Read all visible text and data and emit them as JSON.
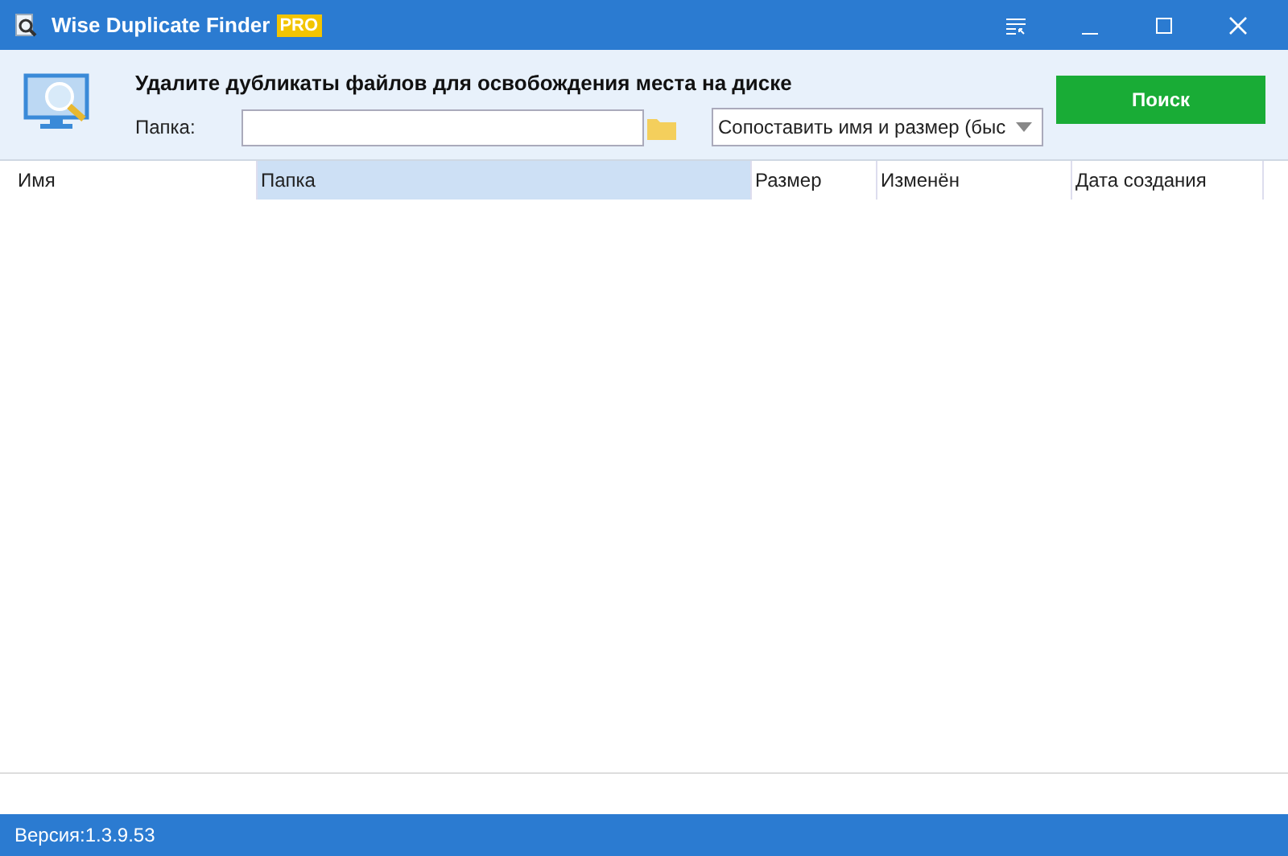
{
  "window": {
    "title": "Wise Duplicate Finder",
    "badge": "PRO"
  },
  "header": {
    "heading": "Удалите дубликаты файлов для освобождения места на диске",
    "folder_label": "Папка:",
    "mode": "Сопоставить имя и размер (быс",
    "search_button": "Поиск"
  },
  "table": {
    "columns": [
      {
        "label": "Имя",
        "selected": false
      },
      {
        "label": "Папка",
        "selected": true
      },
      {
        "label": "Размер",
        "selected": false
      },
      {
        "label": "Изменён",
        "selected": false
      },
      {
        "label": "Дата создания",
        "selected": false
      }
    ]
  },
  "status_bar": {
    "version": "Версия:1.3.9.53"
  }
}
